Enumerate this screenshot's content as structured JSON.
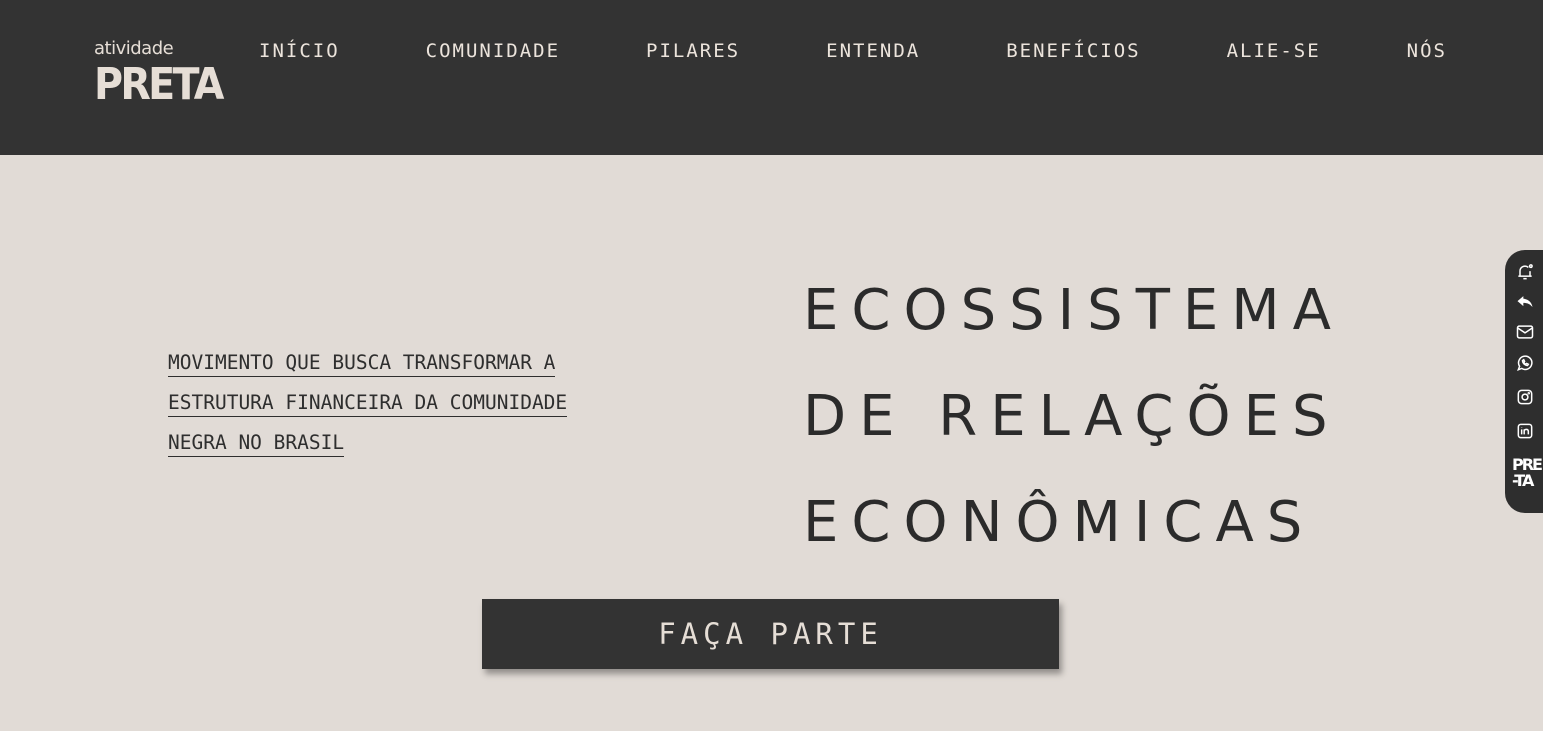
{
  "brand": {
    "logo_top": "atividade",
    "logo_bottom": "PRETA"
  },
  "nav": {
    "items": [
      {
        "label": "INÍCIO"
      },
      {
        "label": "COMUNIDADE"
      },
      {
        "label": "PILARES"
      },
      {
        "label": "ENTENDA"
      },
      {
        "label": "BENEFÍCIOS"
      },
      {
        "label": "ALIE-SE"
      },
      {
        "label": "NÓS"
      }
    ]
  },
  "hero": {
    "subtitle_lines": [
      "MOVIMENTO QUE BUSCA TRANSFORMAR A",
      "ESTRUTURA FINANCEIRA DA COMUNIDADE",
      "NEGRA NO BRASIL"
    ],
    "headline_lines": [
      "ECOSSISTEMA",
      "DE RELAÇÕES",
      "ECONÔMICAS"
    ],
    "cta_label": "FAÇA PARTE"
  },
  "side_rail": {
    "icons": [
      "bell-icon",
      "reply-icon",
      "mail-icon",
      "whatsapp-icon",
      "instagram-icon",
      "linkedin-icon"
    ],
    "logo_line1": "PRE",
    "logo_line2": "-TA"
  },
  "colors": {
    "header_bg": "#333333",
    "page_bg": "#e1dbd6",
    "text_dark": "#2b2b2b",
    "text_light": "#ece4dc"
  }
}
